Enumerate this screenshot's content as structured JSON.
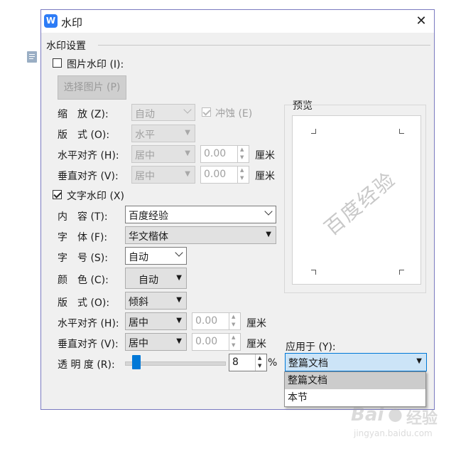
{
  "window": {
    "title": "水印",
    "app_icon": "W",
    "close": "✕"
  },
  "group_title": "水印设置",
  "picture": {
    "checkbox_label": "图片水印 (I):",
    "select_button": "选择图片 (P)",
    "scale_label": "缩　放 (Z):",
    "scale_value": "自动",
    "washout_label": "冲蚀 (E)",
    "layout_label": "版　式 (O):",
    "layout_value": "水平",
    "h_align_label": "水平对齐 (H):",
    "h_align_value": "居中",
    "h_offset": "0.00",
    "h_unit": "厘米",
    "v_align_label": "垂直对齐 (V):",
    "v_align_value": "居中",
    "v_offset": "0.00",
    "v_unit": "厘米"
  },
  "text": {
    "checkbox_label": "文字水印 (X)",
    "content_label": "内　容 (T):",
    "content_value": "百度经验",
    "font_label": "字　体 (F):",
    "font_value": "华文楷体",
    "size_label": "字　号 (S):",
    "size_value": "自动",
    "color_label": "颜　色 (C):",
    "color_value": "自动",
    "layout_label": "版　式 (O):",
    "layout_value": "倾斜",
    "h_align_label": "水平对齐 (H):",
    "h_align_value": "居中",
    "h_offset": "0.00",
    "h_unit": "厘米",
    "v_align_label": "垂直对齐 (V):",
    "v_align_value": "居中",
    "v_offset": "0.00",
    "v_unit": "厘米",
    "transparency_label": "透 明 度 (R):",
    "transparency_value": "8",
    "transparency_unit": "%"
  },
  "preview": {
    "label": "预览",
    "watermark": "百度经验"
  },
  "apply": {
    "label": "应用于 (Y):",
    "value": "整篇文档",
    "options": [
      "整篇文档",
      "本节"
    ]
  },
  "watermark_overlay": {
    "brand": "Bai",
    "brand_suffix": "经验",
    "url": "jingyan.baidu.com"
  },
  "colors": {
    "accent": "#2d7cf6",
    "selection": "#cce4f7",
    "dialog_bg": "#f0f0f0",
    "border": "#7a7ac0"
  }
}
